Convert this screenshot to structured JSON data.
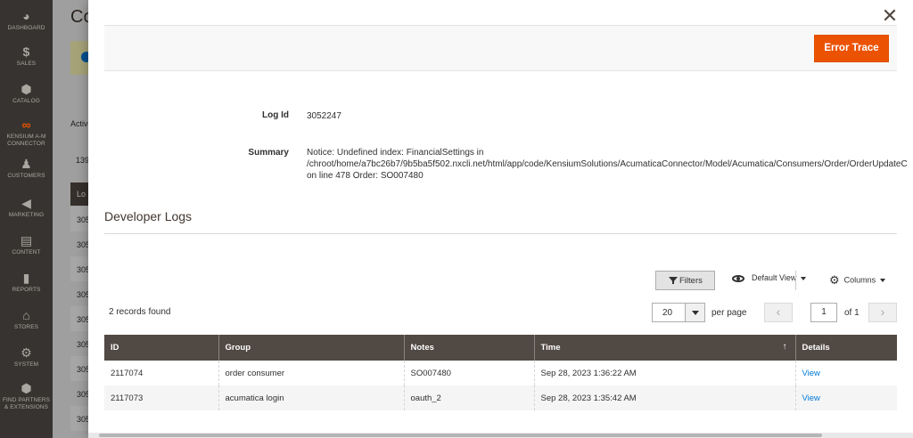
{
  "sidebar": {
    "items": [
      {
        "label": "DASHBOARD",
        "icon": "dashboard-icon",
        "glyph": "◕"
      },
      {
        "label": "SALES",
        "icon": "dollar-icon",
        "glyph": "$"
      },
      {
        "label": "CATALOG",
        "icon": "box-icon",
        "glyph": "⬢"
      },
      {
        "label": "KENSIUM A-M CONNECTOR",
        "icon": "connector-icon",
        "glyph": "∞"
      },
      {
        "label": "CUSTOMERS",
        "icon": "person-icon",
        "glyph": "♟"
      },
      {
        "label": "MARKETING",
        "icon": "megaphone-icon",
        "glyph": "◀"
      },
      {
        "label": "CONTENT",
        "icon": "layout-icon",
        "glyph": "▤"
      },
      {
        "label": "REPORTS",
        "icon": "bar-chart-icon",
        "glyph": "▮"
      },
      {
        "label": "STORES",
        "icon": "store-icon",
        "glyph": "⌂"
      },
      {
        "label": "SYSTEM",
        "icon": "gear-icon",
        "glyph": "⚙"
      },
      {
        "label": "FIND PARTNERS & EXTENSIONS",
        "icon": "cube-icon",
        "glyph": "⬢"
      }
    ],
    "connector_color": "#eb5202"
  },
  "background_page": {
    "title": "Co",
    "active_text": "Activ",
    "count_text": "139",
    "table_header": "Lo",
    "rows": [
      "305",
      "305",
      "305",
      "305",
      "305",
      "305",
      "305",
      "305",
      "305"
    ]
  },
  "modal": {
    "close_symbol": "✕",
    "error_trace_button": "Error Trace",
    "log_id_label": "Log Id",
    "log_id_value": "3052247",
    "summary_label": "Summary",
    "summary_lines": [
      "Notice: Undefined index: FinancialSettings in",
      "/chroot/home/a7bc26b7/9b5ba5f502.nxcli.net/html/app/code/KensiumSolutions/AcumaticaConnector/Model/Acumatica/Consumers/Order/OrderUpdateC",
      "on line 478 Order: SO007480"
    ],
    "section_title": "Developer Logs"
  },
  "grid_controls": {
    "filters_label": "Filters",
    "view_label": "Default View",
    "columns_label": "Columns",
    "records_found": "2 records found",
    "per_page_value": "20",
    "per_page_label": "per page",
    "prev_symbol": "‹",
    "next_symbol": "›",
    "current_page": "1",
    "page_of": "of 1"
  },
  "grid": {
    "columns": [
      "ID",
      "Group",
      "Notes",
      "Time",
      "Details"
    ],
    "sort_indicator": "↑",
    "rows": [
      {
        "id": "2117074",
        "group": "order consumer",
        "notes": "SO007480",
        "time": "Sep 28, 2023 1:36:22 AM",
        "details": "View"
      },
      {
        "id": "2117073",
        "group": "acumatica login",
        "notes": "oauth_2",
        "time": "Sep 28, 2023 1:35:42 AM",
        "details": "View"
      }
    ]
  },
  "colors": {
    "accent": "#eb5202",
    "header_bg": "#514943",
    "link": "#007bdb",
    "sidebar_bg": "#373330"
  }
}
